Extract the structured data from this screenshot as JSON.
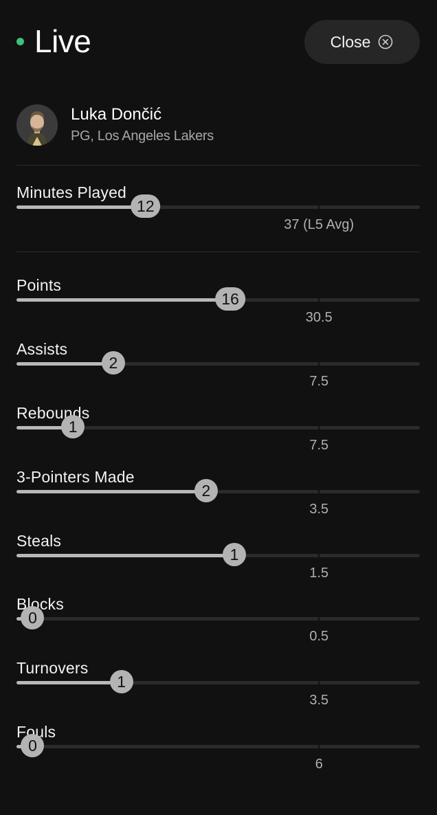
{
  "header": {
    "live_label": "Live",
    "live_color": "#3fbf7a",
    "close_label": "Close",
    "close_icon": "circle-x-icon"
  },
  "player": {
    "name": "Luka Dončić",
    "subtitle": "PG, Los Angeles Lakers",
    "avatar_icon": "player-headshot"
  },
  "stats": [
    {
      "key": "minutes",
      "label": "Minutes Played",
      "value": 12,
      "value_label": "12",
      "line_label": "37 (L5 Avg)",
      "progress": 0.32,
      "marker": 0.75
    },
    {
      "key": "points",
      "label": "Points",
      "value": 16,
      "value_label": "16",
      "line_label": "30.5",
      "progress": 0.53,
      "marker": 0.75
    },
    {
      "key": "assists",
      "label": "Assists",
      "value": 2,
      "value_label": "2",
      "line_label": "7.5",
      "progress": 0.24,
      "marker": 0.75
    },
    {
      "key": "rebounds",
      "label": "Rebounds",
      "value": 1,
      "value_label": "1",
      "line_label": "7.5",
      "progress": 0.14,
      "marker": 0.75
    },
    {
      "key": "threes",
      "label": "3-Pointers Made",
      "value": 2,
      "value_label": "2",
      "line_label": "3.5",
      "progress": 0.47,
      "marker": 0.75
    },
    {
      "key": "steals",
      "label": "Steals",
      "value": 1,
      "value_label": "1",
      "line_label": "1.5",
      "progress": 0.54,
      "marker": 0.75
    },
    {
      "key": "blocks",
      "label": "Blocks",
      "value": 0,
      "value_label": "0",
      "line_label": "0.5",
      "progress": 0.04,
      "marker": 0.75
    },
    {
      "key": "turnovers",
      "label": "Turnovers",
      "value": 1,
      "value_label": "1",
      "line_label": "3.5",
      "progress": 0.26,
      "marker": 0.75
    },
    {
      "key": "fouls",
      "label": "Fouls",
      "value": 0,
      "value_label": "0",
      "line_label": "6",
      "progress": 0.04,
      "marker": 0.75
    }
  ]
}
